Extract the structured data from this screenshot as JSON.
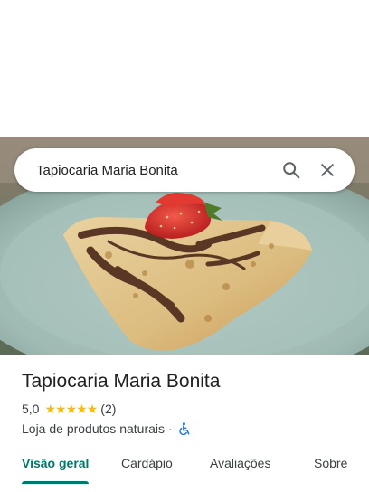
{
  "search": {
    "query": "Tapiocaria Maria Bonita",
    "search_icon": "search-icon",
    "close_icon": "close-icon"
  },
  "hero": {
    "subject": "tapioca-with-chocolate-and-strawberry-photo"
  },
  "place": {
    "name": "Tapiocaria Maria Bonita",
    "rating": "5,0",
    "stars": 5,
    "review_count": "(2)",
    "category": "Loja de produtos naturais",
    "separator": "·",
    "accessibility_icon": "wheelchair-icon"
  },
  "tabs": [
    {
      "label": "Visão geral",
      "active": true
    },
    {
      "label": "Cardápio",
      "active": false
    },
    {
      "label": "Avaliações",
      "active": false
    },
    {
      "label": "Sobre",
      "active": false
    }
  ],
  "colors": {
    "accent": "#00796b",
    "star": "#fbbc04",
    "text": "#202124",
    "secondary": "#3c4043"
  }
}
